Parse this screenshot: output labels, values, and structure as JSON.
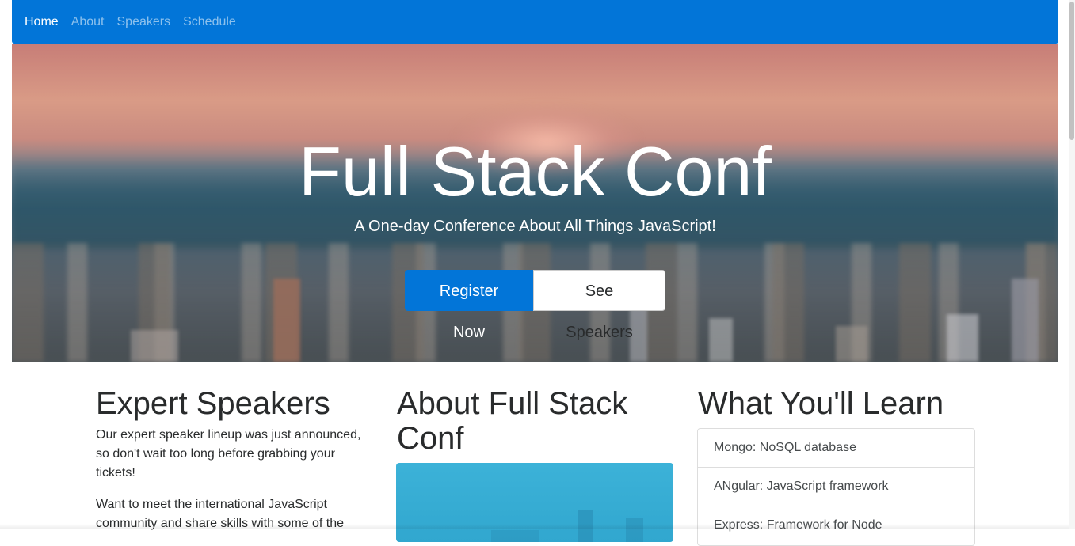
{
  "nav": {
    "items": [
      {
        "label": "Home",
        "active": true
      },
      {
        "label": "About",
        "active": false
      },
      {
        "label": "Speakers",
        "active": false
      },
      {
        "label": "Schedule",
        "active": false
      }
    ]
  },
  "hero": {
    "title": "Full Stack Conf",
    "subtitle": "A One-day Conference About All Things JavaScript!",
    "register_label": "Register Now",
    "speakers_label": "See Speakers"
  },
  "sections": {
    "speakers": {
      "heading": "Expert Speakers",
      "paragraphs": [
        "Our expert speaker lineup was just announced, so don't wait too long before grabbing your tickets!",
        "Want to meet the international JavaScript community and share skills with some of the"
      ]
    },
    "about": {
      "heading": "About Full Stack Conf"
    },
    "learn": {
      "heading": "What You'll Learn",
      "items": [
        "Mongo: NoSQL database",
        "ANgular: JavaScript framework",
        "Express: Framework for Node"
      ]
    }
  },
  "colors": {
    "primary": "#0275d8",
    "text": "#292b2c",
    "white": "#ffffff"
  }
}
